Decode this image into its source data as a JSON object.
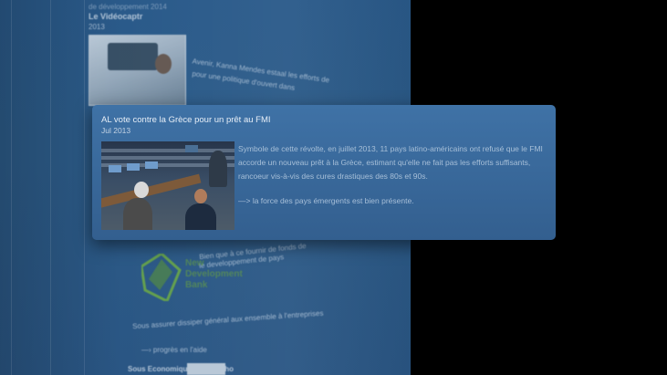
{
  "background": {
    "section_title": "Le Vidéocaptr",
    "lines": [
      "de développement 2014",
      "2013",
      "Avenir, Kanna Mendes estaal les efforts de",
      "pour une politique d'ouvert dans",
      "Bien que à ce fournir de fonds de",
      "le developpement de pays",
      "Sous assurer dissiper général aux ensemble à l'entreprises",
      "—› progrès en l'aide",
      "Sous Economique Ronaldinho"
    ],
    "logo_text": [
      "New",
      "Development",
      "Bank"
    ]
  },
  "card": {
    "title": "AL vote contre la Grèce pour un prêt au FMI",
    "date": "Jul 2013",
    "paragraph": "Symbole de cette révolte, en juillet 2013, 11 pays latino-américains ont refusé que le FMI accorde un nouveau prêt à la Grèce, estimant qu'elle ne fait pas les efforts suffisants, rancoeur vis-à-vis des cures drastiques des 80s et 90s.",
    "conclusion": "—> la force des pays émergents est bien présente."
  },
  "colors": {
    "panel": "#2c5b88",
    "card": "#3a6a9c",
    "card_text": "#a7bfd8",
    "logo_green": "#6fa83a"
  }
}
